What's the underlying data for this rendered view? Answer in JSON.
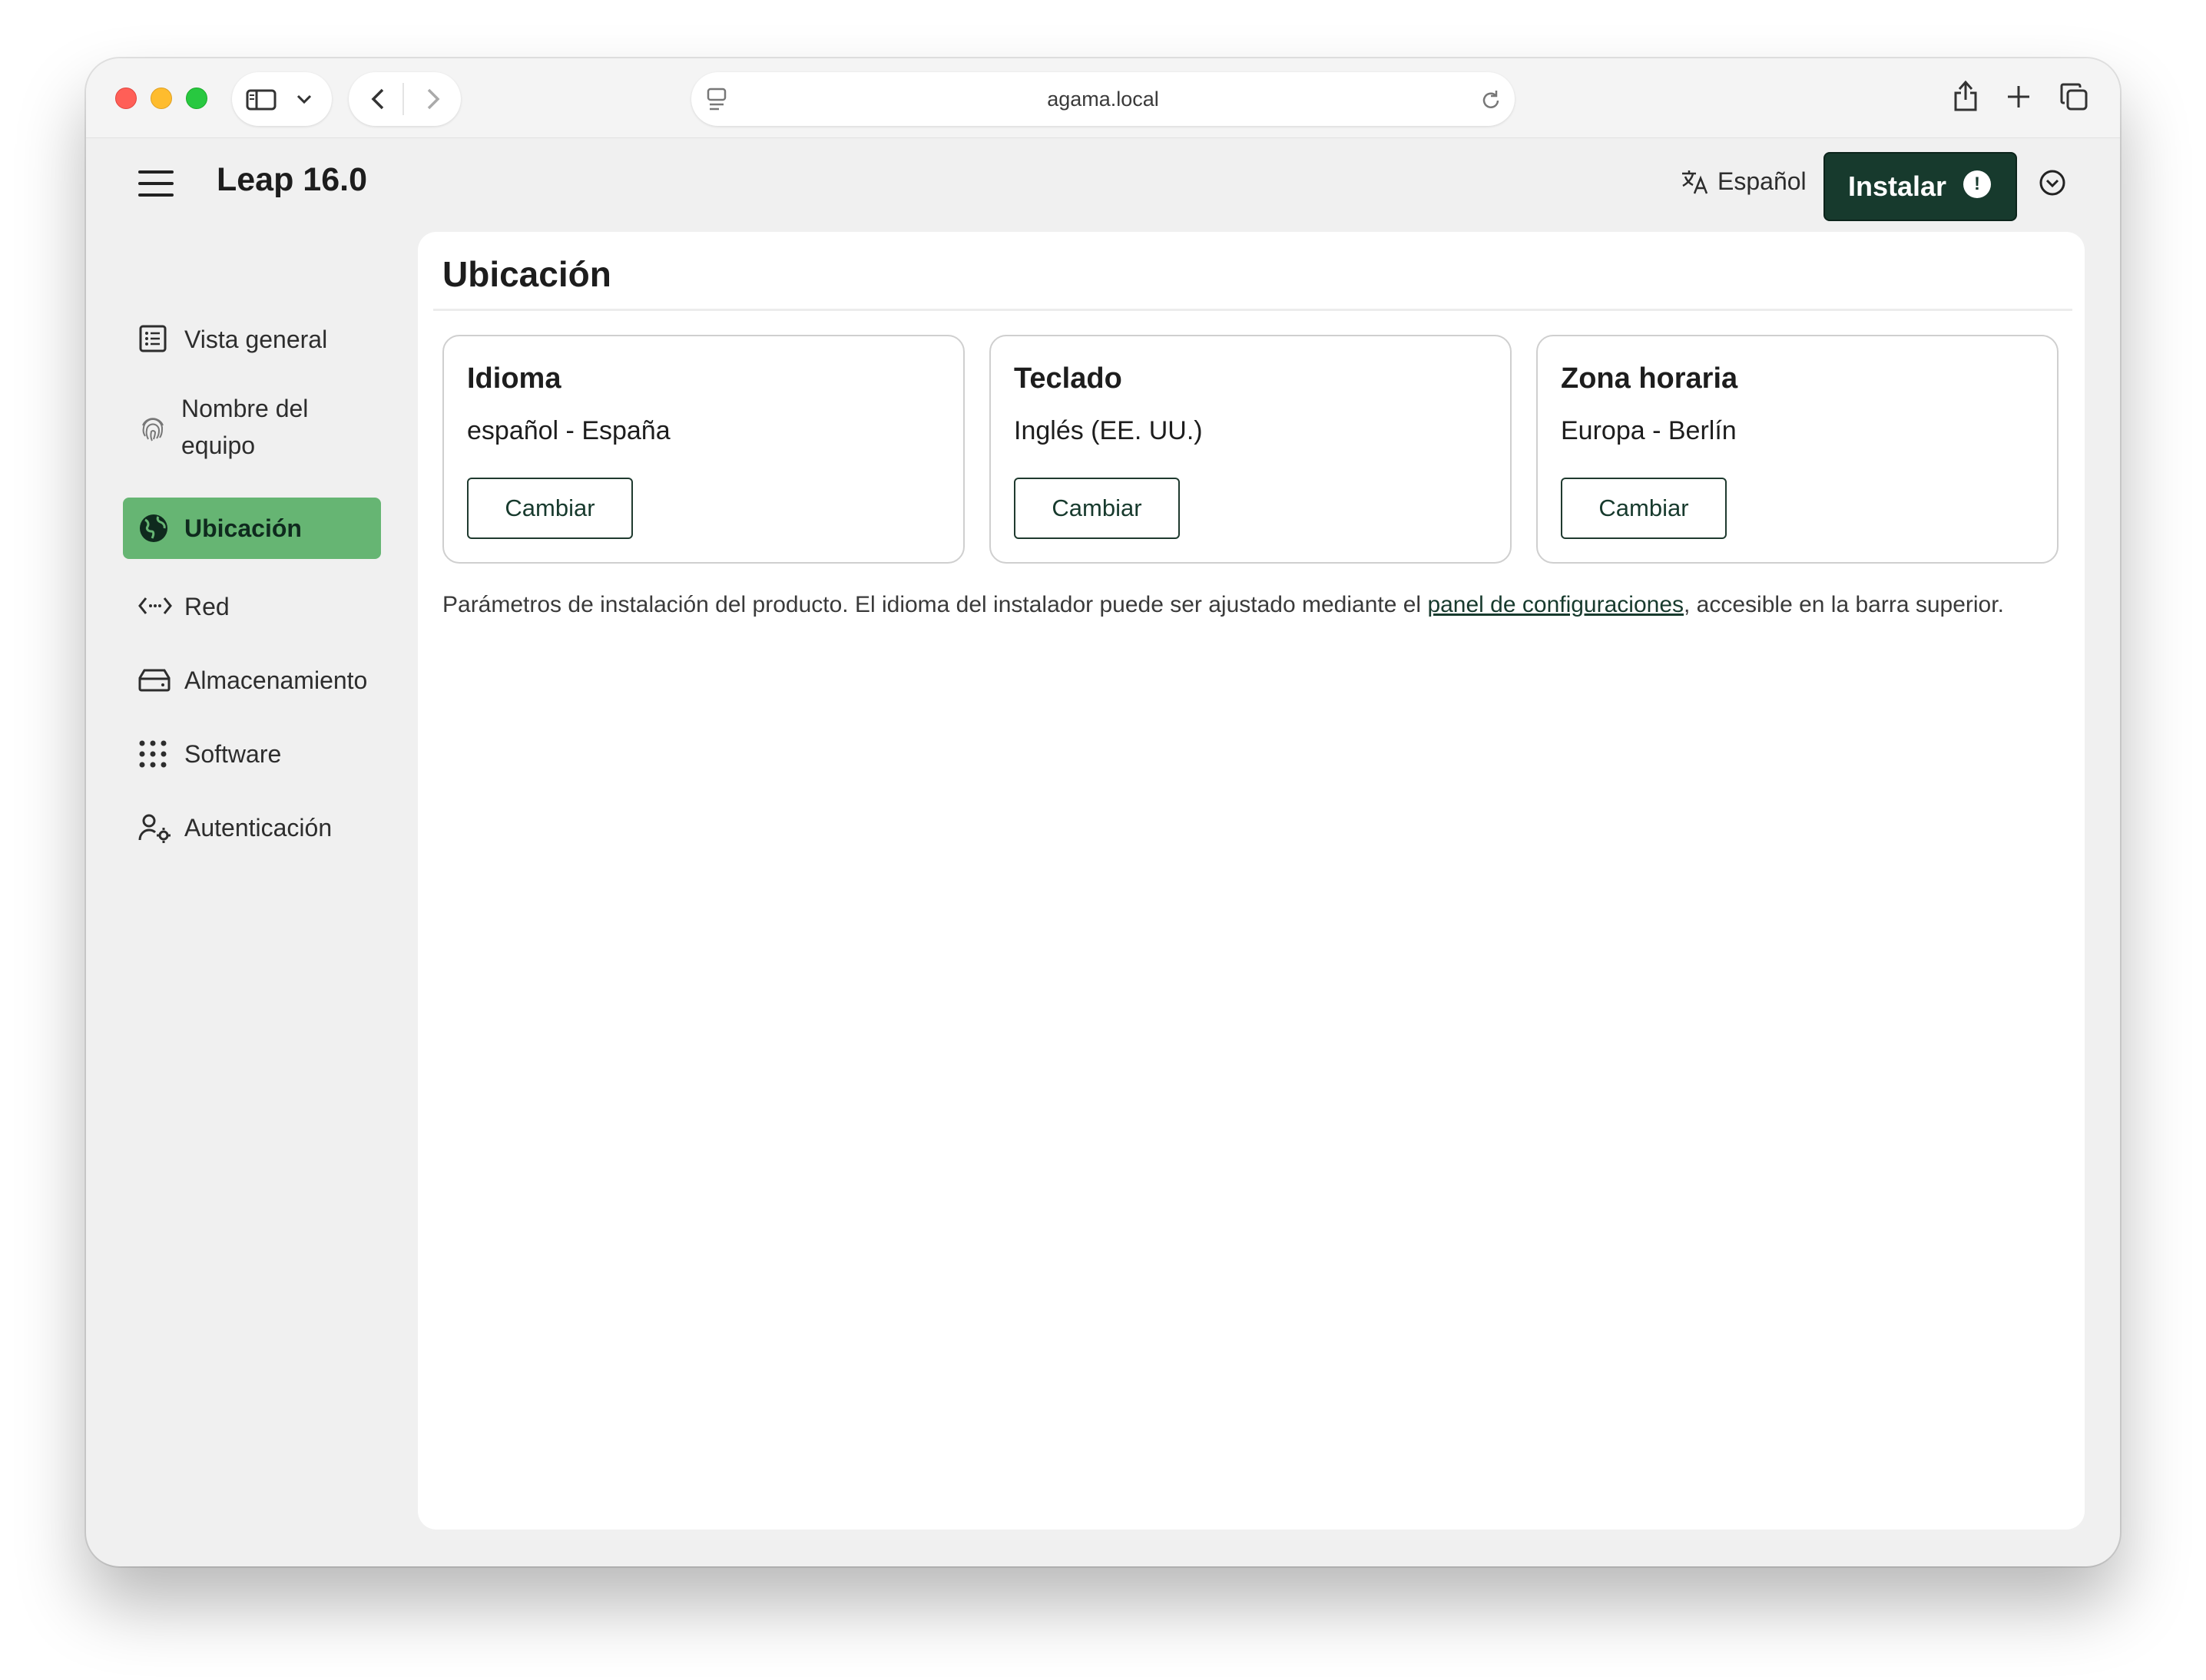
{
  "browser": {
    "url": "agama.local"
  },
  "header": {
    "product": "Leap 16.0",
    "language_label": "Español",
    "install_label": "Instalar",
    "install_badge": "!"
  },
  "sidebar": {
    "items": [
      {
        "label": "Vista general",
        "icon": "overview-list-icon"
      },
      {
        "label": "Nombre del equipo",
        "icon": "fingerprint-icon"
      },
      {
        "label": "Ubicación",
        "icon": "globe-icon",
        "active": true
      },
      {
        "label": "Red",
        "icon": "network-code-icon"
      },
      {
        "label": "Almacenamiento",
        "icon": "storage-drive-icon"
      },
      {
        "label": "Software",
        "icon": "apps-grid-icon"
      },
      {
        "label": "Autenticación",
        "icon": "user-settings-icon"
      }
    ]
  },
  "main": {
    "title": "Ubicación",
    "cards": [
      {
        "title": "Idioma",
        "value": "español - España",
        "button": "Cambiar"
      },
      {
        "title": "Teclado",
        "value": "Inglés (EE. UU.)",
        "button": "Cambiar"
      },
      {
        "title": "Zona horaria",
        "value": "Europa - Berlín",
        "button": "Cambiar"
      }
    ],
    "description_before": "Parámetros de instalación del producto. El idioma del instalador puede ser ajustado mediante el ",
    "description_link": "panel de configuraciones",
    "description_after": ", accesible en la barra superior."
  },
  "colors": {
    "accent_active": "#66b573",
    "install_bg": "#173a2d"
  }
}
